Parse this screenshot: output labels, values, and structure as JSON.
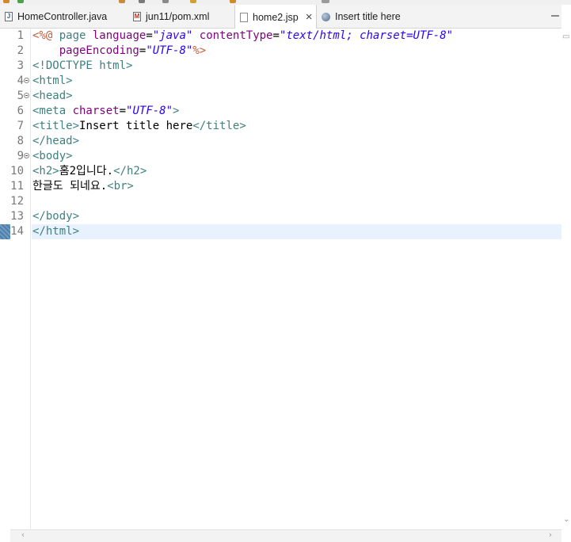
{
  "tabs": [
    {
      "label": "HomeController.java",
      "icon": "java-file-icon",
      "active": false
    },
    {
      "label": "jun11/pom.xml",
      "icon": "maven-file-icon",
      "active": false
    },
    {
      "label": "home2.jsp",
      "icon": "jsp-file-icon",
      "active": true,
      "close": "×"
    },
    {
      "label": "Insert title here",
      "icon": "browser-globe-icon",
      "active": false
    }
  ],
  "editor": {
    "current_line": 14,
    "lines": [
      {
        "num": "1",
        "fold": false,
        "segments": [
          {
            "t": "<%@ ",
            "c": "dir"
          },
          {
            "t": "page ",
            "c": "tag"
          },
          {
            "t": "language",
            "c": "attr"
          },
          {
            "t": "=",
            "c": "txt"
          },
          {
            "t": "\"java\"",
            "c": "str"
          },
          {
            "t": " ",
            "c": "txt"
          },
          {
            "t": "contentType",
            "c": "attr"
          },
          {
            "t": "=",
            "c": "txt"
          },
          {
            "t": "\"text/html; charset=UTF-8\"",
            "c": "str"
          }
        ]
      },
      {
        "num": "2",
        "fold": false,
        "segments": [
          {
            "t": "    ",
            "c": "txt"
          },
          {
            "t": "pageEncoding",
            "c": "attr"
          },
          {
            "t": "=",
            "c": "txt"
          },
          {
            "t": "\"UTF-8\"",
            "c": "str"
          },
          {
            "t": "%>",
            "c": "dir"
          }
        ]
      },
      {
        "num": "3",
        "fold": false,
        "segments": [
          {
            "t": "<!DOCTYPE html>",
            "c": "tag"
          }
        ]
      },
      {
        "num": "4",
        "fold": true,
        "segments": [
          {
            "t": "<html>",
            "c": "tag"
          }
        ]
      },
      {
        "num": "5",
        "fold": true,
        "segments": [
          {
            "t": "<head>",
            "c": "tag"
          }
        ]
      },
      {
        "num": "6",
        "fold": false,
        "segments": [
          {
            "t": "<meta ",
            "c": "tag"
          },
          {
            "t": "charset",
            "c": "attr"
          },
          {
            "t": "=",
            "c": "txt"
          },
          {
            "t": "\"UTF-8\"",
            "c": "str"
          },
          {
            "t": ">",
            "c": "tag"
          }
        ]
      },
      {
        "num": "7",
        "fold": false,
        "segments": [
          {
            "t": "<title>",
            "c": "tag"
          },
          {
            "t": "Insert title here",
            "c": "txt"
          },
          {
            "t": "</title>",
            "c": "tag"
          }
        ]
      },
      {
        "num": "8",
        "fold": false,
        "segments": [
          {
            "t": "</head>",
            "c": "tag"
          }
        ]
      },
      {
        "num": "9",
        "fold": true,
        "segments": [
          {
            "t": "<body>",
            "c": "tag"
          }
        ]
      },
      {
        "num": "10",
        "fold": false,
        "segments": [
          {
            "t": "<h2>",
            "c": "tag"
          },
          {
            "t": "홈2입니다.",
            "c": "txt"
          },
          {
            "t": "</h2>",
            "c": "tag"
          }
        ]
      },
      {
        "num": "11",
        "fold": false,
        "segments": [
          {
            "t": "한글도 되네요.",
            "c": "txt"
          },
          {
            "t": "<br>",
            "c": "tag"
          }
        ]
      },
      {
        "num": "12",
        "fold": false,
        "segments": []
      },
      {
        "num": "13",
        "fold": false,
        "segments": [
          {
            "t": "</body>",
            "c": "tag"
          }
        ]
      },
      {
        "num": "14",
        "fold": false,
        "segments": [
          {
            "t": "</html>",
            "c": "tag"
          }
        ]
      }
    ]
  },
  "colors": {
    "tag": "#3f8080",
    "attr": "#7f007f",
    "string": "#2a00ff",
    "directive": "#bf5f3f",
    "text": "#000000",
    "current_line": "#e8f2fe"
  }
}
